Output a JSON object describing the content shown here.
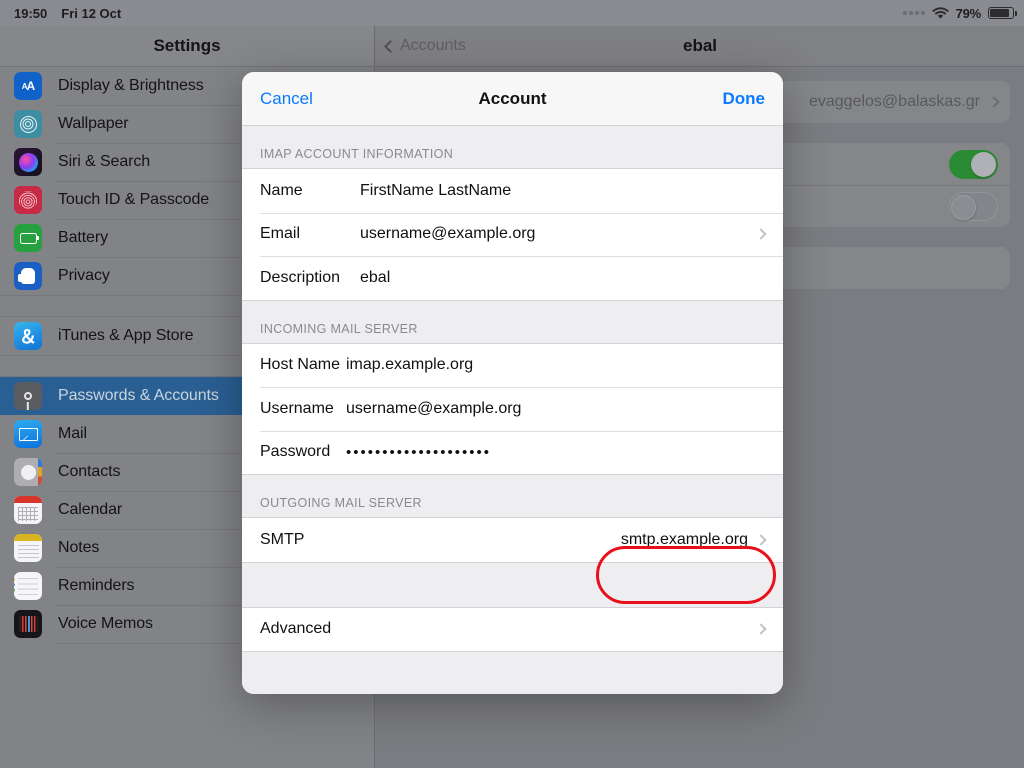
{
  "status_bar": {
    "time": "19:50",
    "date": "Fri 12 Oct",
    "battery_percent": "79%",
    "wifi_icon": "wifi-icon",
    "signal_icon": "signal-dots-icon",
    "battery_icon": "battery-icon"
  },
  "sidebar": {
    "title": "Settings",
    "items": [
      {
        "label": "Display & Brightness",
        "icon": "display-brightness-icon",
        "selected": false
      },
      {
        "label": "Wallpaper",
        "icon": "wallpaper-icon",
        "selected": false
      },
      {
        "label": "Siri & Search",
        "icon": "siri-search-icon",
        "selected": false
      },
      {
        "label": "Touch ID & Passcode",
        "icon": "touchid-icon",
        "selected": false
      },
      {
        "label": "Battery",
        "icon": "battery-icon",
        "selected": false
      },
      {
        "label": "Privacy",
        "icon": "privacy-hand-icon",
        "selected": false
      },
      {
        "label": "iTunes & App Store",
        "icon": "app-store-icon",
        "selected": false
      },
      {
        "label": "Passwords & Accounts",
        "icon": "key-icon",
        "selected": true
      },
      {
        "label": "Mail",
        "icon": "mail-icon",
        "selected": false
      },
      {
        "label": "Contacts",
        "icon": "contacts-icon",
        "selected": false
      },
      {
        "label": "Calendar",
        "icon": "calendar-icon",
        "selected": false
      },
      {
        "label": "Notes",
        "icon": "notes-icon",
        "selected": false
      },
      {
        "label": "Reminders",
        "icon": "reminders-icon",
        "selected": false
      },
      {
        "label": "Voice Memos",
        "icon": "voice-memos-icon",
        "selected": false
      }
    ]
  },
  "detail_panel": {
    "back_label": "Accounts",
    "title": "ebal",
    "account_row": {
      "value": "evaggelos@balaskas.gr",
      "chevron": "chevron-right-icon"
    },
    "toggles": [
      {
        "state": "on"
      },
      {
        "state": "off"
      }
    ]
  },
  "modal": {
    "cancel_label": "Cancel",
    "title": "Account",
    "done_label": "Done",
    "sections": [
      {
        "header": "IMAP ACCOUNT INFORMATION",
        "rows": [
          {
            "key": "Name",
            "value": "FirstName LastName",
            "chevron": false
          },
          {
            "key": "Email",
            "value": "username@example.org",
            "chevron": true
          },
          {
            "key": "Description",
            "value": "ebal",
            "chevron": false
          }
        ]
      },
      {
        "header": "INCOMING MAIL SERVER",
        "rows": [
          {
            "key": "Host Name",
            "value": "imap.example.org",
            "chevron": false
          },
          {
            "key": "Username",
            "value": "username@example.org",
            "chevron": false
          },
          {
            "key": "Password",
            "value": "••••••••••••••••••••",
            "chevron": false
          }
        ]
      },
      {
        "header": "OUTGOING MAIL SERVER",
        "rows": [
          {
            "key": "SMTP",
            "value": "smtp.example.org",
            "chevron": true,
            "highlighted": true
          }
        ]
      }
    ],
    "advanced_row": {
      "key": "Advanced",
      "chevron": true
    }
  },
  "annotation": {
    "color": "#e8111b",
    "target": "smtp-row-value"
  }
}
